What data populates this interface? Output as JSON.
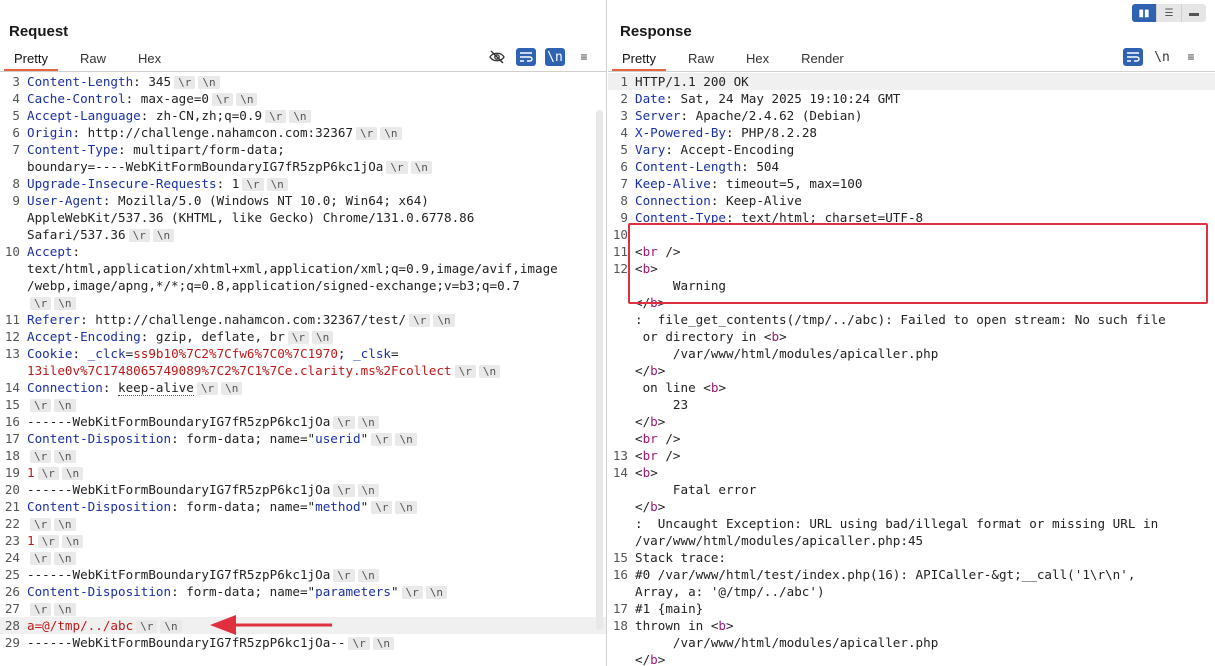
{
  "request": {
    "title": "Request",
    "tabs": [
      "Pretty",
      "Raw",
      "Hex"
    ],
    "lines": [
      {
        "n": "3",
        "segs": [
          {
            "t": "Content-Length",
            "c": "hdr"
          },
          {
            "t": ": 345"
          }
        ],
        "crlf": true
      },
      {
        "n": "4",
        "segs": [
          {
            "t": "Cache-Control",
            "c": "hdr"
          },
          {
            "t": ": max-age=0"
          }
        ],
        "crlf": true
      },
      {
        "n": "5",
        "segs": [
          {
            "t": "Accept-Language",
            "c": "hdr"
          },
          {
            "t": ": zh-CN,zh;q=0.9"
          }
        ],
        "crlf": true
      },
      {
        "n": "6",
        "segs": [
          {
            "t": "Origin",
            "c": "hdr"
          },
          {
            "t": ": http://challenge.nahamcon.com:32367"
          }
        ],
        "crlf": true
      },
      {
        "n": "7",
        "segs": [
          {
            "t": "Content-Type",
            "c": "hdr"
          },
          {
            "t": ": multipart/form-data;\nboundary=----WebKitFormBoundaryIG7fR5zpP6kc1jOa"
          }
        ],
        "crlf": true
      },
      {
        "n": "8",
        "segs": [
          {
            "t": "Upgrade-Insecure-Requests",
            "c": "hdr"
          },
          {
            "t": ": 1"
          }
        ],
        "crlf": true
      },
      {
        "n": "9",
        "segs": [
          {
            "t": "User-Agent",
            "c": "hdr"
          },
          {
            "t": ": Mozilla/5.0 (Windows NT 10.0; Win64; x64)\nAppleWebKit/537.36 (KHTML, like Gecko) Chrome/131.0.6778.86\nSafari/537.36"
          }
        ],
        "crlf": true
      },
      {
        "n": "10",
        "segs": [
          {
            "t": "Accept",
            "c": "hdr"
          },
          {
            "t": ":\ntext/html,application/xhtml+xml,application/xml;q=0.9,image/avif,image\n/webp,image/apng,*/*;q=0.8,application/signed-exchange;v=b3;q=0.7\n"
          }
        ],
        "crlf": true
      },
      {
        "n": "11",
        "segs": [
          {
            "t": "Referer",
            "c": "hdr"
          },
          {
            "t": ": http://challenge.nahamcon.com:32367/test/"
          }
        ],
        "crlf": true
      },
      {
        "n": "12",
        "segs": [
          {
            "t": "Accept-Encoding",
            "c": "hdr"
          },
          {
            "t": ": gzip, deflate, br"
          }
        ],
        "crlf": true
      },
      {
        "n": "13",
        "segs": [
          {
            "t": "Cookie",
            "c": "hdr"
          },
          {
            "t": ": "
          },
          {
            "t": "_clck",
            "c": "hdr"
          },
          {
            "t": "="
          },
          {
            "t": "ss9b10%7C2%7Cfw6%7C0%7C1970",
            "c": "val"
          },
          {
            "t": "; "
          },
          {
            "t": "_clsk",
            "c": "hdr"
          },
          {
            "t": "=\n"
          },
          {
            "t": "13ile0v%7C1748065749089%7C2%7C1%7Ce.clarity.ms%2Fcollect",
            "c": "val"
          }
        ],
        "crlf": true
      },
      {
        "n": "14",
        "segs": [
          {
            "t": "Connection",
            "c": "hdr"
          },
          {
            "t": ": "
          },
          {
            "t": "keep-alive",
            "c": "dotted"
          }
        ],
        "crlf": true
      },
      {
        "n": "15",
        "segs": [],
        "crlf": true
      },
      {
        "n": "16",
        "segs": [
          {
            "t": "------WebKitFormBoundaryIG7fR5zpP6kc1jOa"
          }
        ],
        "crlf": true
      },
      {
        "n": "17",
        "segs": [
          {
            "t": "Content-Disposition",
            "c": "hdr"
          },
          {
            "t": ": form-data; name=\""
          },
          {
            "t": "userid",
            "c": "hdr"
          },
          {
            "t": "\""
          }
        ],
        "crlf": true
      },
      {
        "n": "18",
        "segs": [],
        "crlf": true
      },
      {
        "n": "19",
        "segs": [
          {
            "t": "1",
            "c": "val"
          }
        ],
        "crlf": true
      },
      {
        "n": "20",
        "segs": [
          {
            "t": "------WebKitFormBoundaryIG7fR5zpP6kc1jOa"
          }
        ],
        "crlf": true
      },
      {
        "n": "21",
        "segs": [
          {
            "t": "Content-Disposition",
            "c": "hdr"
          },
          {
            "t": ": form-data; name=\""
          },
          {
            "t": "method",
            "c": "hdr"
          },
          {
            "t": "\""
          }
        ],
        "crlf": true
      },
      {
        "n": "22",
        "segs": [],
        "crlf": true
      },
      {
        "n": "23",
        "segs": [
          {
            "t": "1",
            "c": "val"
          }
        ],
        "crlf": true
      },
      {
        "n": "24",
        "segs": [],
        "crlf": true
      },
      {
        "n": "25",
        "segs": [
          {
            "t": "------WebKitFormBoundaryIG7fR5zpP6kc1jOa"
          }
        ],
        "crlf": true
      },
      {
        "n": "26",
        "segs": [
          {
            "t": "Content-Disposition",
            "c": "hdr"
          },
          {
            "t": ": form-data; name=\""
          },
          {
            "t": "parameters",
            "c": "hdr"
          },
          {
            "t": "\""
          }
        ],
        "crlf": true
      },
      {
        "n": "27",
        "segs": [],
        "crlf": true
      },
      {
        "n": "28",
        "segs": [
          {
            "t": "a=@/tmp/../abc",
            "c": "val"
          }
        ],
        "crlf": true,
        "hl": true
      },
      {
        "n": "29",
        "segs": [
          {
            "t": "------WebKitFormBoundaryIG7fR5zpP6kc1jOa--"
          }
        ],
        "crlf": true
      }
    ]
  },
  "response": {
    "title": "Response",
    "tabs": [
      "Pretty",
      "Raw",
      "Hex",
      "Render"
    ],
    "lines": [
      {
        "n": "1",
        "segs": [
          {
            "t": "HTTP/1.1 200 OK"
          }
        ],
        "hl": true
      },
      {
        "n": "2",
        "segs": [
          {
            "t": "Date",
            "c": "hdr"
          },
          {
            "t": ": Sat, 24 May 2025 19:10:24 GMT"
          }
        ]
      },
      {
        "n": "3",
        "segs": [
          {
            "t": "Server",
            "c": "hdr"
          },
          {
            "t": ": Apache/2.4.62 (Debian)"
          }
        ]
      },
      {
        "n": "4",
        "segs": [
          {
            "t": "X-Powered-By",
            "c": "hdr"
          },
          {
            "t": ": PHP/8.2.28"
          }
        ]
      },
      {
        "n": "5",
        "segs": [
          {
            "t": "Vary",
            "c": "hdr"
          },
          {
            "t": ": Accept-Encoding"
          }
        ]
      },
      {
        "n": "6",
        "segs": [
          {
            "t": "Content-Length",
            "c": "hdr"
          },
          {
            "t": ": 504"
          }
        ]
      },
      {
        "n": "7",
        "segs": [
          {
            "t": "Keep-Alive",
            "c": "hdr"
          },
          {
            "t": ": timeout=5, max=100"
          }
        ]
      },
      {
        "n": "8",
        "segs": [
          {
            "t": "Connection",
            "c": "hdr"
          },
          {
            "t": ": Keep-Alive"
          }
        ]
      },
      {
        "n": "9",
        "segs": [
          {
            "t": "Content-Type",
            "c": "hdr"
          },
          {
            "t": ": text/html; charset=UTF-8"
          }
        ]
      },
      {
        "n": "10",
        "segs": []
      },
      {
        "n": "11",
        "segs": [
          {
            "t": "<"
          },
          {
            "t": "br",
            "c": "tagc"
          },
          {
            "t": " />"
          }
        ]
      },
      {
        "n": "12",
        "segs": [
          {
            "t": "<"
          },
          {
            "t": "b",
            "c": "tagc"
          },
          {
            "t": ">\n     Warning\n</"
          },
          {
            "t": "b",
            "c": "tagc"
          },
          {
            "t": ">\n:  file_get_contents(/tmp/../abc): Failed to open stream: No such file\n or directory in <"
          },
          {
            "t": "b",
            "c": "tagc"
          },
          {
            "t": ">\n     /var/www/html/modules/apicaller.php\n</"
          },
          {
            "t": "b",
            "c": "tagc"
          },
          {
            "t": ">\n on line <"
          },
          {
            "t": "b",
            "c": "tagc"
          },
          {
            "t": ">\n     23\n</"
          },
          {
            "t": "b",
            "c": "tagc"
          },
          {
            "t": ">\n<"
          },
          {
            "t": "br",
            "c": "tagc"
          },
          {
            "t": " />"
          }
        ]
      },
      {
        "n": "13",
        "segs": [
          {
            "t": "<"
          },
          {
            "t": "br",
            "c": "tagc"
          },
          {
            "t": " />"
          }
        ]
      },
      {
        "n": "14",
        "segs": [
          {
            "t": "<"
          },
          {
            "t": "b",
            "c": "tagc"
          },
          {
            "t": ">\n     Fatal error\n</"
          },
          {
            "t": "b",
            "c": "tagc"
          },
          {
            "t": ">\n:  Uncaught Exception: URL using bad/illegal format or missing URL in\n/var/www/html/modules/apicaller.php:45"
          }
        ]
      },
      {
        "n": "15",
        "segs": [
          {
            "t": "Stack trace:"
          }
        ]
      },
      {
        "n": "16",
        "segs": [
          {
            "t": "#0 /var/www/html/test/index.php(16): APICaller-&gt;__call('1\\r\\n',\nArray, a: '@/tmp/../abc')"
          }
        ]
      },
      {
        "n": "17",
        "segs": [
          {
            "t": "#1 {main}"
          }
        ]
      },
      {
        "n": "18",
        "segs": [
          {
            "t": "thrown in <"
          },
          {
            "t": "b",
            "c": "tagc"
          },
          {
            "t": ">\n     /var/www/html/modules/apicaller.php\n</"
          },
          {
            "t": "b",
            "c": "tagc"
          },
          {
            "t": ">"
          }
        ]
      }
    ]
  },
  "crlf_tokens": [
    "\\r",
    "\\n"
  ],
  "toolbar": {
    "newline_label": "\\n",
    "menu_label": "≡"
  },
  "colors": {
    "accent": "#e8663d",
    "blue": "#2f63b2",
    "header": "#1b2fa6",
    "value": "#c01818",
    "tag": "#a1187a",
    "highlight": "#e03040"
  }
}
